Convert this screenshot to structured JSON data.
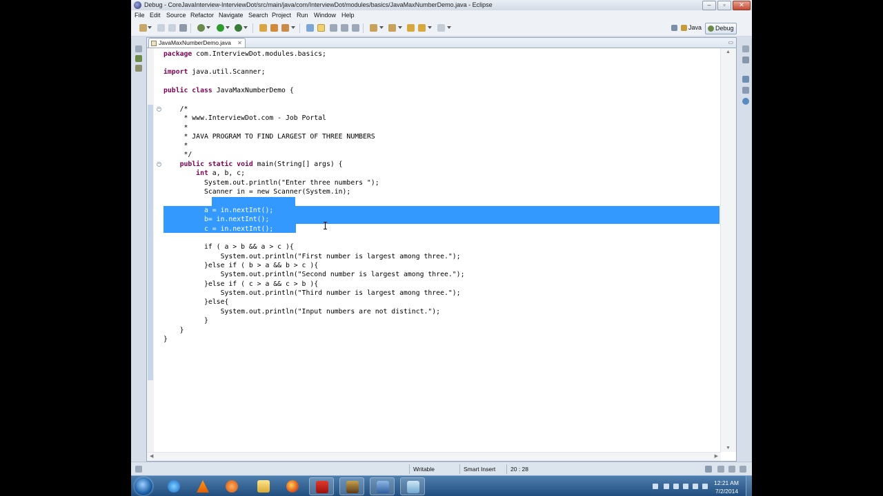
{
  "window": {
    "title": "Debug - CoreJavaInterview-InterviewDot/src/main/java/com/InterviewDot/modules/basics/JavaMaxNumberDemo.java - Eclipse",
    "controls": [
      "minimize",
      "maximize",
      "close"
    ]
  },
  "menu": [
    "File",
    "Edit",
    "Source",
    "Refactor",
    "Navigate",
    "Search",
    "Project",
    "Run",
    "Window",
    "Help"
  ],
  "perspectives": {
    "java_label": "Java",
    "debug_label": "Debug",
    "active": "Debug"
  },
  "editor": {
    "tab_title": "JavaMaxNumberDemo.java",
    "lines": [
      "package com.InterviewDot.modules.basics;",
      "",
      "import java.util.Scanner;",
      "",
      "public class JavaMaxNumberDemo {",
      "",
      "    /*",
      "     * www.InterviewDot.com - Job Portal",
      "     *",
      "     * JAVA PROGRAM TO FIND LARGEST OF THREE NUMBERS",
      "     *",
      "     */",
      "    public static void main(String[] args) {",
      "        int a, b, c;",
      "          System.out.println(\"Enter three numbers \");",
      "          Scanner in = new Scanner(System.in);",
      "",
      "          a = in.nextInt();",
      "          b= in.nextInt();",
      "          c = in.nextInt();",
      "",
      "          if ( a > b && a > c ){",
      "              System.out.println(\"First number is largest among three.\");",
      "          }else if ( b > a && b > c ){",
      "              System.out.println(\"Second number is largest among three.\");",
      "          }else if ( c > a && c > b ){",
      "              System.out.println(\"Third number is largest among three.\");",
      "          }else{",
      "              System.out.println(\"Input numbers are not distinct.\");",
      "          }",
      "    }",
      "}"
    ],
    "selected_lines": [
      18,
      19,
      20
    ]
  },
  "status": {
    "writable": "Writable",
    "insert_mode": "Smart Insert",
    "position": "20 : 28"
  },
  "taskbar": {
    "apps": [
      "internet-explorer",
      "vlc",
      "media-player",
      "file-explorer",
      "firefox",
      "flash",
      "game-app",
      "save-app",
      "notes-app"
    ],
    "time": "12:21 AM",
    "date": "7/2/2014"
  }
}
